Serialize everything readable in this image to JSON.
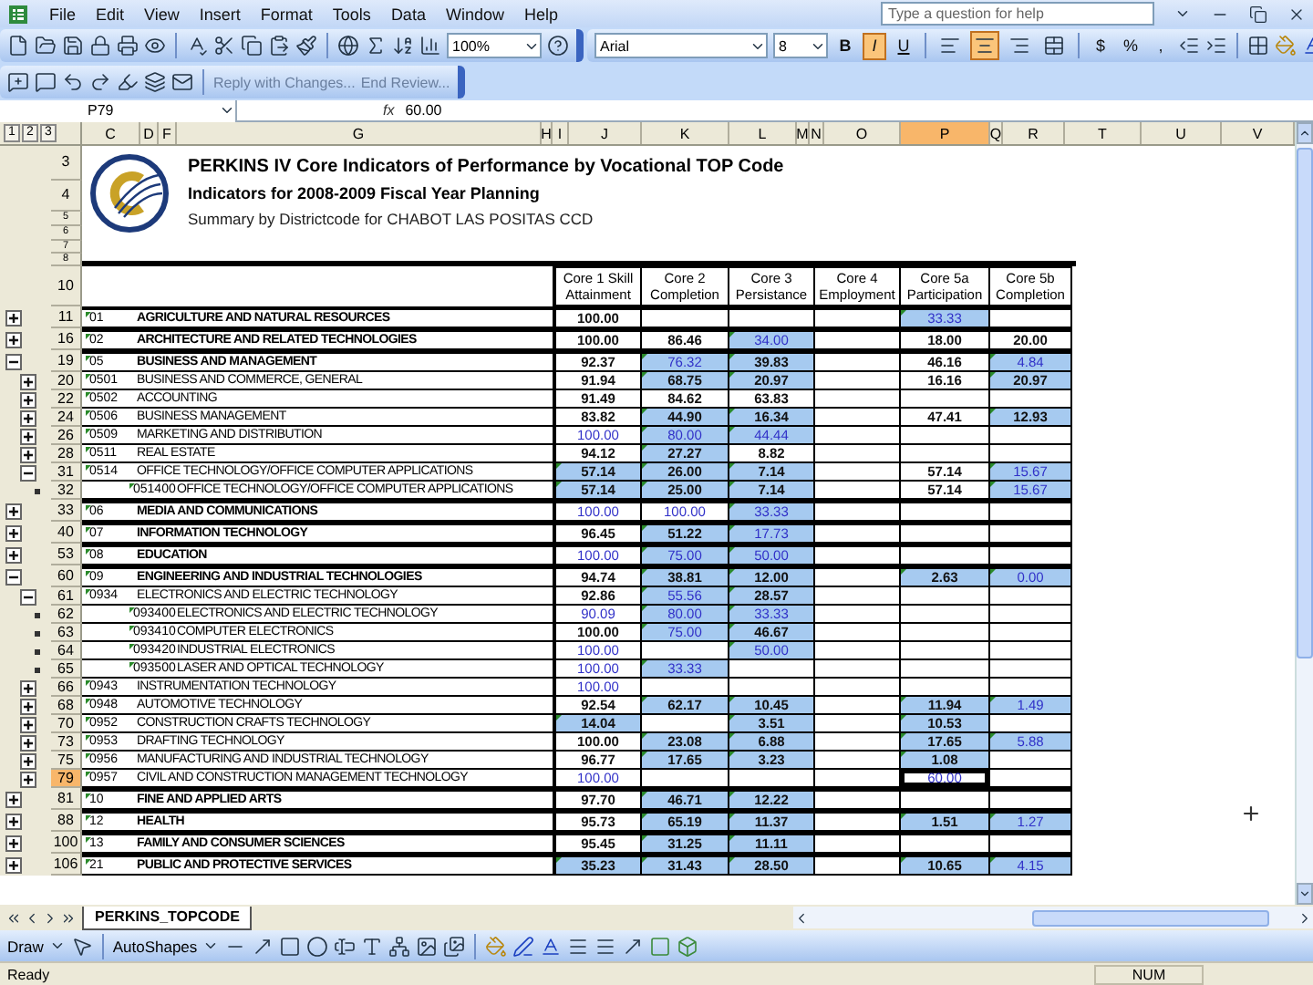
{
  "menu": {
    "items": [
      "File",
      "Edit",
      "View",
      "Insert",
      "Format",
      "Tools",
      "Data",
      "Window",
      "Help"
    ],
    "help_box": {
      "placeholder": "Type a question for help"
    }
  },
  "standard_toolbar": {
    "zoom": "100%"
  },
  "formatting_toolbar": {
    "font": "Arial",
    "size": "8",
    "style_buttons": [
      {
        "label": "B",
        "pressed": false
      },
      {
        "label": "I",
        "pressed": true
      },
      {
        "label": "U",
        "pressed": false
      }
    ],
    "alignment_buttons": [
      {
        "kind": "left",
        "pressed": false
      },
      {
        "kind": "center",
        "pressed": true
      },
      {
        "kind": "right",
        "pressed": false
      },
      {
        "kind": "merge",
        "pressed": false
      }
    ],
    "number_buttons": [
      "$",
      "%",
      ","
    ]
  },
  "reviewing_toolbar": {
    "reply": "Reply with Changes...",
    "end": "End Review..."
  },
  "formula_bar": {
    "name_box": "P79",
    "fx": "fx",
    "value": "60.00"
  },
  "outline_levels": [
    "1",
    "2",
    "3"
  ],
  "columns": [
    {
      "label": "C",
      "selected": false
    },
    {
      "label": "D",
      "selected": false
    },
    {
      "label": "F",
      "selected": false
    },
    {
      "label": "G",
      "selected": false
    },
    {
      "label": "H",
      "selected": false
    },
    {
      "label": "I",
      "selected": false
    },
    {
      "label": "J",
      "selected": false
    },
    {
      "label": "K",
      "selected": false
    },
    {
      "label": "L",
      "selected": false
    },
    {
      "label": "M",
      "selected": false
    },
    {
      "label": "N",
      "selected": false
    },
    {
      "label": "O",
      "selected": false
    },
    {
      "label": "P",
      "selected": true
    },
    {
      "label": "Q",
      "selected": false
    },
    {
      "label": "R",
      "selected": false
    },
    {
      "label": "T",
      "selected": false
    },
    {
      "label": "U",
      "selected": false
    },
    {
      "label": "V",
      "selected": false
    }
  ],
  "title_block": {
    "row_numbers": [
      "3",
      "4",
      "5",
      "6",
      "7",
      "8"
    ],
    "title": "PERKINS IV Core Indicators of Performance by Vocational TOP Code",
    "subtitle": "Indicators for 2008-2009 Fiscal Year Planning",
    "summary": "Summary by Districtcode for CHABOT LAS POSITAS CCD"
  },
  "header_row": {
    "row": "10",
    "labels": [
      [
        "Core 1 Skill",
        "Attainment"
      ],
      [
        "Core 2",
        "Completion"
      ],
      [
        "Core 3",
        "Persistance"
      ],
      [
        "Core 4",
        "Employment"
      ],
      [
        "Core 5a",
        "Participation"
      ],
      [
        "Core 5b",
        "Completion"
      ]
    ]
  },
  "rows": [
    {
      "row": "11",
      "code": "01",
      "name": "AGRICULTURE AND NATURAL RESOURCES",
      "expanded": false,
      "selected": false,
      "cells": [
        {
          "v": "100.00",
          "shaded": false,
          "blue": false
        },
        null,
        null,
        null,
        {
          "v": "33.33",
          "shaded": true,
          "blue": true
        },
        null
      ]
    },
    {
      "row": "16",
      "code": "02",
      "name": "ARCHITECTURE AND RELATED TECHNOLOGIES",
      "expanded": false,
      "selected": false,
      "cells": [
        {
          "v": "100.00",
          "shaded": false,
          "blue": false
        },
        {
          "v": "86.46",
          "shaded": false,
          "blue": false
        },
        {
          "v": "34.00",
          "shaded": true,
          "blue": true
        },
        null,
        {
          "v": "18.00",
          "shaded": false,
          "blue": false
        },
        {
          "v": "20.00",
          "shaded": false,
          "blue": false
        }
      ]
    },
    {
      "row": "19",
      "code": "05",
      "name": "BUSINESS AND MANAGEMENT",
      "expanded": true,
      "selected": false,
      "cells": [
        {
          "v": "92.37",
          "shaded": false,
          "blue": false
        },
        {
          "v": "76.32",
          "shaded": true,
          "blue": true
        },
        {
          "v": "39.83",
          "shaded": true,
          "blue": false
        },
        null,
        {
          "v": "46.16",
          "shaded": false,
          "blue": false
        },
        {
          "v": "4.84",
          "shaded": true,
          "blue": true
        }
      ],
      "children": [
        {
          "row": "20",
          "code": "0501",
          "name": "BUSINESS AND COMMERCE, GENERAL",
          "expanded": false,
          "selected": false,
          "cells": [
            {
              "v": "91.94",
              "shaded": false,
              "blue": false
            },
            {
              "v": "68.75",
              "shaded": true,
              "blue": false
            },
            {
              "v": "20.97",
              "shaded": true,
              "blue": false
            },
            null,
            {
              "v": "16.16",
              "shaded": false,
              "blue": false
            },
            {
              "v": "20.97",
              "shaded": true,
              "blue": false
            }
          ]
        },
        {
          "row": "22",
          "code": "0502",
          "name": "ACCOUNTING",
          "expanded": false,
          "selected": false,
          "cells": [
            {
              "v": "91.49",
              "shaded": false,
              "blue": false
            },
            {
              "v": "84.62",
              "shaded": false,
              "blue": false
            },
            {
              "v": "63.83",
              "shaded": false,
              "blue": false
            },
            null,
            null,
            null
          ]
        },
        {
          "row": "24",
          "code": "0506",
          "name": "BUSINESS MANAGEMENT",
          "expanded": false,
          "selected": false,
          "cells": [
            {
              "v": "83.82",
              "shaded": false,
              "blue": false
            },
            {
              "v": "44.90",
              "shaded": true,
              "blue": false
            },
            {
              "v": "16.34",
              "shaded": true,
              "blue": false
            },
            null,
            {
              "v": "47.41",
              "shaded": false,
              "blue": false
            },
            {
              "v": "12.93",
              "shaded": true,
              "blue": false
            }
          ]
        },
        {
          "row": "26",
          "code": "0509",
          "name": "MARKETING AND DISTRIBUTION",
          "expanded": false,
          "selected": false,
          "cells": [
            {
              "v": "100.00",
              "shaded": false,
              "blue": true
            },
            {
              "v": "80.00",
              "shaded": true,
              "blue": true
            },
            {
              "v": "44.44",
              "shaded": true,
              "blue": true
            },
            null,
            null,
            null
          ]
        },
        {
          "row": "28",
          "code": "0511",
          "name": "REAL ESTATE",
          "expanded": false,
          "selected": false,
          "cells": [
            {
              "v": "94.12",
              "shaded": false,
              "blue": false
            },
            {
              "v": "27.27",
              "shaded": true,
              "blue": false
            },
            {
              "v": "8.82",
              "shaded": false,
              "blue": false
            },
            null,
            null,
            null
          ]
        },
        {
          "row": "31",
          "code": "0514",
          "name": "OFFICE TECHNOLOGY/OFFICE COMPUTER APPLICATIONS",
          "expanded": true,
          "selected": false,
          "cells": [
            {
              "v": "57.14",
              "shaded": true,
              "blue": false
            },
            {
              "v": "26.00",
              "shaded": true,
              "blue": false
            },
            {
              "v": "7.14",
              "shaded": true,
              "blue": false
            },
            null,
            {
              "v": "57.14",
              "shaded": false,
              "blue": false
            },
            {
              "v": "15.67",
              "shaded": true,
              "blue": true
            }
          ],
          "children": [
            {
              "row": "32",
              "code": "051400",
              "name": "OFFICE TECHNOLOGY/OFFICE COMPUTER APPLICATIONS",
              "selected": false,
              "cells": [
                {
                  "v": "57.14",
                  "shaded": true,
                  "blue": false
                },
                {
                  "v": "25.00",
                  "shaded": true,
                  "blue": false
                },
                {
                  "v": "7.14",
                  "shaded": true,
                  "blue": false
                },
                null,
                {
                  "v": "57.14",
                  "shaded": false,
                  "blue": false
                },
                {
                  "v": "15.67",
                  "shaded": true,
                  "blue": true
                }
              ]
            }
          ]
        }
      ]
    },
    {
      "row": "33",
      "code": "06",
      "name": "MEDIA AND COMMUNICATIONS",
      "expanded": false,
      "selected": false,
      "cells": [
        {
          "v": "100.00",
          "shaded": false,
          "blue": true
        },
        {
          "v": "100.00",
          "shaded": false,
          "blue": true
        },
        {
          "v": "33.33",
          "shaded": true,
          "blue": true
        },
        null,
        null,
        null
      ]
    },
    {
      "row": "40",
      "code": "07",
      "name": "INFORMATION TECHNOLOGY",
      "expanded": false,
      "selected": false,
      "cells": [
        {
          "v": "96.45",
          "shaded": false,
          "blue": false
        },
        {
          "v": "51.22",
          "shaded": true,
          "blue": false
        },
        {
          "v": "17.73",
          "shaded": true,
          "blue": true
        },
        null,
        null,
        null
      ]
    },
    {
      "row": "53",
      "code": "08",
      "name": "EDUCATION",
      "expanded": false,
      "selected": false,
      "cells": [
        {
          "v": "100.00",
          "shaded": false,
          "blue": true
        },
        {
          "v": "75.00",
          "shaded": true,
          "blue": true
        },
        {
          "v": "50.00",
          "shaded": true,
          "blue": true
        },
        null,
        null,
        null
      ]
    },
    {
      "row": "60",
      "code": "09",
      "name": "ENGINEERING AND INDUSTRIAL TECHNOLOGIES",
      "expanded": true,
      "selected": false,
      "cells": [
        {
          "v": "94.74",
          "shaded": false,
          "blue": false
        },
        {
          "v": "38.81",
          "shaded": true,
          "blue": false
        },
        {
          "v": "12.00",
          "shaded": true,
          "blue": false
        },
        null,
        {
          "v": "2.63",
          "shaded": true,
          "blue": false
        },
        {
          "v": "0.00",
          "shaded": true,
          "blue": true
        }
      ],
      "children": [
        {
          "row": "61",
          "code": "0934",
          "name": "ELECTRONICS AND ELECTRIC TECHNOLOGY",
          "expanded": true,
          "selected": false,
          "cells": [
            {
              "v": "92.86",
              "shaded": false,
              "blue": false
            },
            {
              "v": "55.56",
              "shaded": true,
              "blue": true
            },
            {
              "v": "28.57",
              "shaded": true,
              "blue": false
            },
            null,
            null,
            null
          ],
          "children": [
            {
              "row": "62",
              "code": "093400",
              "name": "ELECTRONICS AND ELECTRIC TECHNOLOGY",
              "selected": false,
              "cells": [
                {
                  "v": "90.09",
                  "shaded": false,
                  "blue": true
                },
                {
                  "v": "80.00",
                  "shaded": true,
                  "blue": true
                },
                {
                  "v": "33.33",
                  "shaded": true,
                  "blue": true
                },
                null,
                null,
                null
              ]
            },
            {
              "row": "63",
              "code": "093410",
              "name": "COMPUTER ELECTRONICS",
              "selected": false,
              "cells": [
                {
                  "v": "100.00",
                  "shaded": false,
                  "blue": false
                },
                {
                  "v": "75.00",
                  "shaded": true,
                  "blue": true
                },
                {
                  "v": "46.67",
                  "shaded": true,
                  "blue": false
                },
                null,
                null,
                null
              ]
            },
            {
              "row": "64",
              "code": "093420",
              "name": "INDUSTRIAL ELECTRONICS",
              "selected": false,
              "cells": [
                {
                  "v": "100.00",
                  "shaded": false,
                  "blue": true
                },
                null,
                {
                  "v": "50.00",
                  "shaded": true,
                  "blue": true
                },
                null,
                null,
                null
              ]
            },
            {
              "row": "65",
              "code": "093500",
              "name": "LASER AND OPTICAL TECHNOLOGY",
              "selected": false,
              "cells": [
                {
                  "v": "100.00",
                  "shaded": false,
                  "blue": true
                },
                {
                  "v": "33.33",
                  "shaded": true,
                  "blue": true
                },
                null,
                null,
                null,
                null
              ]
            }
          ]
        },
        {
          "row": "66",
          "code": "0943",
          "name": "INSTRUMENTATION TECHNOLOGY",
          "expanded": false,
          "selected": false,
          "cells": [
            {
              "v": "100.00",
              "shaded": false,
              "blue": true
            },
            null,
            null,
            null,
            null,
            null
          ]
        },
        {
          "row": "68",
          "code": "0948",
          "name": "AUTOMOTIVE TECHNOLOGY",
          "expanded": false,
          "selected": false,
          "cells": [
            {
              "v": "92.54",
              "shaded": false,
              "blue": false
            },
            {
              "v": "62.17",
              "shaded": true,
              "blue": false
            },
            {
              "v": "10.45",
              "shaded": true,
              "blue": false
            },
            null,
            {
              "v": "11.94",
              "shaded": true,
              "blue": false
            },
            {
              "v": "1.49",
              "shaded": true,
              "blue": true
            }
          ]
        },
        {
          "row": "70",
          "code": "0952",
          "name": "CONSTRUCTION CRAFTS TECHNOLOGY",
          "expanded": false,
          "selected": false,
          "cells": [
            {
              "v": "14.04",
              "shaded": true,
              "blue": false
            },
            null,
            {
              "v": "3.51",
              "shaded": true,
              "blue": false
            },
            null,
            {
              "v": "10.53",
              "shaded": true,
              "blue": false
            },
            null
          ]
        },
        {
          "row": "73",
          "code": "0953",
          "name": "DRAFTING TECHNOLOGY",
          "expanded": false,
          "selected": false,
          "cells": [
            {
              "v": "100.00",
              "shaded": false,
              "blue": false
            },
            {
              "v": "23.08",
              "shaded": true,
              "blue": false
            },
            {
              "v": "6.88",
              "shaded": true,
              "blue": false
            },
            null,
            {
              "v": "17.65",
              "shaded": true,
              "blue": false
            },
            {
              "v": "5.88",
              "shaded": true,
              "blue": true
            }
          ]
        },
        {
          "row": "75",
          "code": "0956",
          "name": "MANUFACTURING AND INDUSTRIAL TECHNOLOGY",
          "expanded": false,
          "selected": false,
          "cells": [
            {
              "v": "96.77",
              "shaded": false,
              "blue": false
            },
            {
              "v": "17.65",
              "shaded": true,
              "blue": false
            },
            {
              "v": "3.23",
              "shaded": true,
              "blue": false
            },
            null,
            {
              "v": "1.08",
              "shaded": true,
              "blue": false
            },
            null
          ]
        },
        {
          "row": "79",
          "code": "0957",
          "name": "CIVIL AND CONSTRUCTION MANAGEMENT TECHNOLOGY",
          "expanded": false,
          "selected": true,
          "cells": [
            {
              "v": "100.00",
              "shaded": false,
              "blue": true
            },
            null,
            null,
            null,
            {
              "v": "60.00",
              "shaded": false,
              "blue": true
            },
            null
          ]
        }
      ]
    },
    {
      "row": "81",
      "code": "10",
      "name": "FINE AND APPLIED ARTS",
      "expanded": false,
      "selected": false,
      "cells": [
        {
          "v": "97.70",
          "shaded": false,
          "blue": false
        },
        {
          "v": "46.71",
          "shaded": true,
          "blue": false
        },
        {
          "v": "12.22",
          "shaded": true,
          "blue": false
        },
        null,
        null,
        null
      ]
    },
    {
      "row": "88",
      "code": "12",
      "name": "HEALTH",
      "expanded": false,
      "selected": false,
      "cells": [
        {
          "v": "95.73",
          "shaded": false,
          "blue": false
        },
        {
          "v": "65.19",
          "shaded": true,
          "blue": false
        },
        {
          "v": "11.37",
          "shaded": true,
          "blue": false
        },
        null,
        {
          "v": "1.51",
          "shaded": true,
          "blue": false
        },
        {
          "v": "1.27",
          "shaded": true,
          "blue": true
        }
      ]
    },
    {
      "row": "100",
      "code": "13",
      "name": "FAMILY AND CONSUMER SCIENCES",
      "expanded": false,
      "selected": false,
      "cells": [
        {
          "v": "95.45",
          "shaded": false,
          "blue": false
        },
        {
          "v": "31.25",
          "shaded": true,
          "blue": false
        },
        {
          "v": "11.11",
          "shaded": true,
          "blue": false
        },
        null,
        null,
        null
      ]
    },
    {
      "row": "106",
      "code": "21",
      "name": "PUBLIC AND PROTECTIVE SERVICES",
      "expanded": false,
      "selected": false,
      "cells": [
        {
          "v": "35.23",
          "shaded": true,
          "blue": false
        },
        {
          "v": "31.43",
          "shaded": true,
          "blue": false
        },
        {
          "v": "28.50",
          "shaded": true,
          "blue": false
        },
        null,
        {
          "v": "10.65",
          "shaded": true,
          "blue": false
        },
        {
          "v": "4.15",
          "shaded": true,
          "blue": true
        }
      ]
    }
  ],
  "sheet_tabs": [
    {
      "label": "PERKINS_TOPCODE",
      "selected": true
    }
  ],
  "drawing_toolbar": {
    "draw": "Draw",
    "autoshapes": "AutoShapes"
  },
  "status_bar": {
    "left": "Ready",
    "num": "NUM"
  }
}
